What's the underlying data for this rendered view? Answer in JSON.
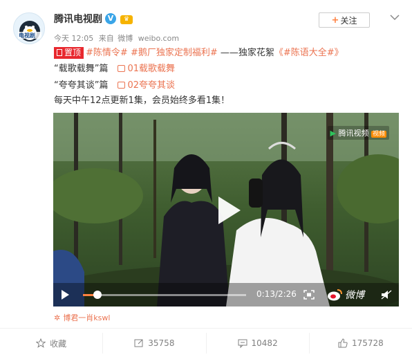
{
  "author": {
    "name": "腾讯电视剧",
    "avatar_text": "电视剧",
    "follow_label": "关注",
    "follow_plus": "+"
  },
  "meta": {
    "time": "今天 12:05",
    "from": "来自",
    "source_app": "微博",
    "source_site": "weibo.com"
  },
  "post": {
    "top_badge": "置顶",
    "hashtag1": "#陈情令#",
    "hashtag2": "#鹅厂独家定制福利#",
    "middle": " ——独家花絮",
    "hashtag3": "《#陈语大全#》",
    "line2_label": "“载歌载舞”篇",
    "line2_link": "01载歌载舞",
    "line3_label": "“夸夸其谈”篇",
    "line3_link": "02夸夸其谈",
    "line4": "每天中午12点更新1集，会员始终多看1集！"
  },
  "video": {
    "watermark": "腾讯视频",
    "watermark_tag": "视频",
    "time_display": "0:13/2:26",
    "progress": 0.09,
    "weibo_mark": "微博"
  },
  "source_tag": "博君一肖kswl",
  "actions": {
    "favorite": "收藏",
    "repost": "35758",
    "comment": "10482",
    "like": "175728"
  },
  "colors": {
    "accent": "#eb7350",
    "top_badge": "#e8282e",
    "verified": "#3aa5e8"
  }
}
